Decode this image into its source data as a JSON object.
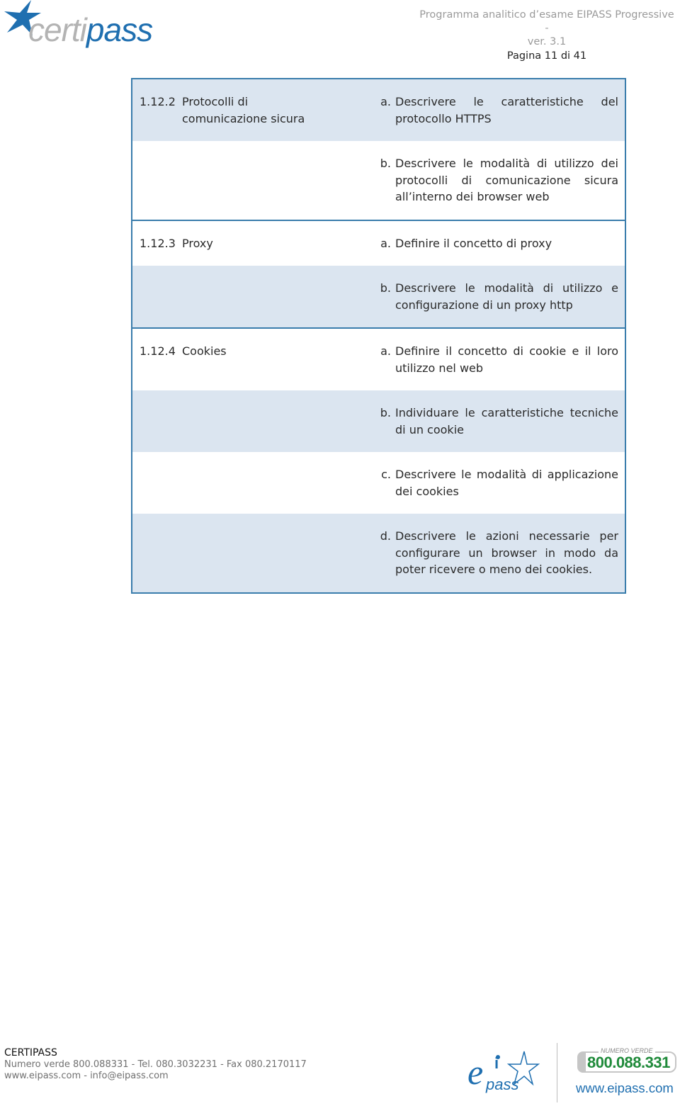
{
  "header": {
    "logo": {
      "icon": "star-icon",
      "text_part1": "certi",
      "text_part2": "pass"
    },
    "doc_title": "Programma analitico d’esame EIPASS Progressive -",
    "doc_version": "ver. 3.1",
    "page_label": "Pagina 11 di 41"
  },
  "table": {
    "groups": [
      {
        "code": "1.12.2",
        "topic": "Protocolli di comunicazione sicura",
        "objectives": [
          {
            "marker": "a.",
            "text": "Descrivere le caratteristiche del protocollo HTTPS",
            "shaded": true
          },
          {
            "marker": "b.",
            "text": "Descrivere le modalità di utilizzo dei protocolli di comunicazione sicura all’interno dei browser web",
            "shaded": false
          }
        ]
      },
      {
        "code": "1.12.3",
        "topic": "Proxy",
        "objectives": [
          {
            "marker": "a.",
            "text": "Definire il concetto di proxy",
            "shaded": false
          },
          {
            "marker": "b.",
            "text": "Descrivere le  modalità di utilizzo e configurazione di un proxy http",
            "shaded": true
          }
        ]
      },
      {
        "code": "1.12.4",
        "topic": "Cookies",
        "objectives": [
          {
            "marker": "a.",
            "text": "Definire il concetto di cookie e il loro utilizzo nel web",
            "shaded": false
          },
          {
            "marker": "b.",
            "text": "Individuare le caratteristiche tecniche di un cookie",
            "shaded": true
          },
          {
            "marker": "c.",
            "text": "Descrivere le modalità di applicazione dei cookies",
            "shaded": false
          },
          {
            "marker": "d.",
            "text": "Descrivere le azioni necessarie per configurare un browser in modo da poter ricevere o meno dei cookies.",
            "shaded": true
          }
        ]
      }
    ]
  },
  "footer": {
    "company": "CERTIPASS",
    "contacts": "Numero verde 800.088331 - Tel. 080.3032231 - Fax 080.2170117",
    "web": "www.eipass.com - info@eipass.com",
    "eipass_logo": {
      "e": "e",
      "i": "i",
      "pass": "pass"
    },
    "numero_verde_label": "NUMERO VERDE",
    "numero_verde_number": "800.088.331",
    "site": "www.eipass.com"
  },
  "colors": {
    "brand_blue": "#1f6fb0",
    "table_border": "#3a7dac",
    "row_shade": "#dbe5f0",
    "numero_verde_green": "#1f8a3a"
  }
}
